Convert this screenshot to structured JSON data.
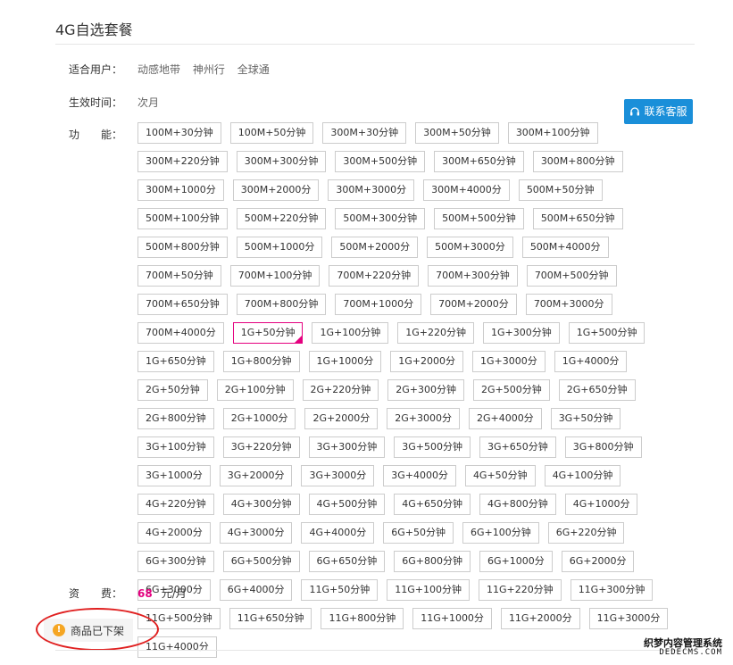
{
  "title": "4G自选套餐",
  "users": {
    "label": "适合用户：",
    "items": [
      "动感地带",
      "神州行",
      "全球通"
    ]
  },
  "effective": {
    "label": "生效时间：",
    "value": "次月"
  },
  "features": {
    "label": "功　　能：",
    "selected_index": 36,
    "options": [
      "100M+30分钟",
      "100M+50分钟",
      "300M+30分钟",
      "300M+50分钟",
      "300M+100分钟",
      "300M+220分钟",
      "300M+300分钟",
      "300M+500分钟",
      "300M+650分钟",
      "300M+800分钟",
      "300M+1000分",
      "300M+2000分",
      "300M+3000分",
      "300M+4000分",
      "500M+50分钟",
      "500M+100分钟",
      "500M+220分钟",
      "500M+300分钟",
      "500M+500分钟",
      "500M+650分钟",
      "500M+800分钟",
      "500M+1000分",
      "500M+2000分",
      "500M+3000分",
      "500M+4000分",
      "700M+50分钟",
      "700M+100分钟",
      "700M+220分钟",
      "700M+300分钟",
      "700M+500分钟",
      "700M+650分钟",
      "700M+800分钟",
      "700M+1000分",
      "700M+2000分",
      "700M+3000分",
      "700M+4000分",
      "1G+50分钟",
      "1G+100分钟",
      "1G+220分钟",
      "1G+300分钟",
      "1G+500分钟",
      "1G+650分钟",
      "1G+800分钟",
      "1G+1000分",
      "1G+2000分",
      "1G+3000分",
      "1G+4000分",
      "2G+50分钟",
      "2G+100分钟",
      "2G+220分钟",
      "2G+300分钟",
      "2G+500分钟",
      "2G+650分钟",
      "2G+800分钟",
      "2G+1000分",
      "2G+2000分",
      "2G+3000分",
      "2G+4000分",
      "3G+50分钟",
      "3G+100分钟",
      "3G+220分钟",
      "3G+300分钟",
      "3G+500分钟",
      "3G+650分钟",
      "3G+800分钟",
      "3G+1000分",
      "3G+2000分",
      "3G+3000分",
      "3G+4000分",
      "4G+50分钟",
      "4G+100分钟",
      "4G+220分钟",
      "4G+300分钟",
      "4G+500分钟",
      "4G+650分钟",
      "4G+800分钟",
      "4G+1000分",
      "4G+2000分",
      "4G+3000分",
      "4G+4000分",
      "6G+50分钟",
      "6G+100分钟",
      "6G+220分钟",
      "6G+300分钟",
      "6G+500分钟",
      "6G+650分钟",
      "6G+800分钟",
      "6G+1000分",
      "6G+2000分",
      "6G+3000分",
      "6G+4000分",
      "11G+50分钟",
      "11G+100分钟",
      "11G+220分钟",
      "11G+300分钟",
      "11G+500分钟",
      "11G+650分钟",
      "11G+800分钟",
      "11G+1000分",
      "11G+2000分",
      "11G+3000分",
      "11G+4000分"
    ]
  },
  "service_button": {
    "label": "联系客服",
    "icon": "headset-icon"
  },
  "fee": {
    "label": "资　　费：",
    "price": "68",
    "unit": "元/月"
  },
  "status": {
    "text": "商品已下架",
    "icon": "info-icon",
    "icon_glyph": "!"
  },
  "watermark": {
    "line1": "织梦内容管理系统",
    "line2": "DEDECMS.COM"
  },
  "colors": {
    "accent": "#e4007f",
    "button": "#1a8fd9",
    "warning": "#f5a623",
    "annotation": "#e02020"
  }
}
